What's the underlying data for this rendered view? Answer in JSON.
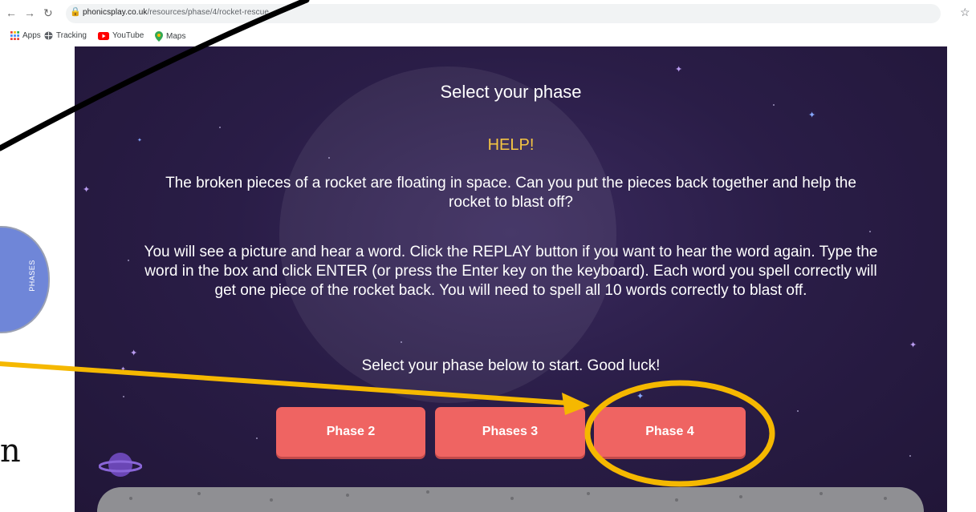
{
  "browser": {
    "url_domain": "phonicsplay.co.uk",
    "url_path": "/resources/phase/4/rocket-rescue",
    "bookmarks": [
      {
        "label": "Apps",
        "icon": "apps-grid-icon"
      },
      {
        "label": "Tracking",
        "icon": "globe-icon"
      },
      {
        "label": "YouTube",
        "icon": "youtube-icon"
      },
      {
        "label": "Maps",
        "icon": "maps-pin-icon"
      }
    ]
  },
  "side_tab": {
    "label": "PHASES"
  },
  "game": {
    "title": "Select your phase",
    "help_heading": "HELP!",
    "paragraph1": "The broken pieces of a rocket are floating in space.  Can you put the pieces back together and help the rocket to blast off?",
    "paragraph2": "You will see a picture and hear a word.  Click the REPLAY button if you want to hear the word again. Type the word in the box and click ENTER (or press the Enter key on the keyboard).  Each word you spell correctly will get one piece of the rocket back.  You will need to spell all 10 words correctly to blast off.",
    "paragraph3": "Select your phase below to start.  Good luck!",
    "buttons": [
      "Phase 2",
      "Phases 3",
      "Phase 4"
    ],
    "selected_button": "Phase 4"
  },
  "annotation": {
    "scribble_text": "n",
    "highlight_color": "#f5b800",
    "pen_color": "#000000"
  }
}
